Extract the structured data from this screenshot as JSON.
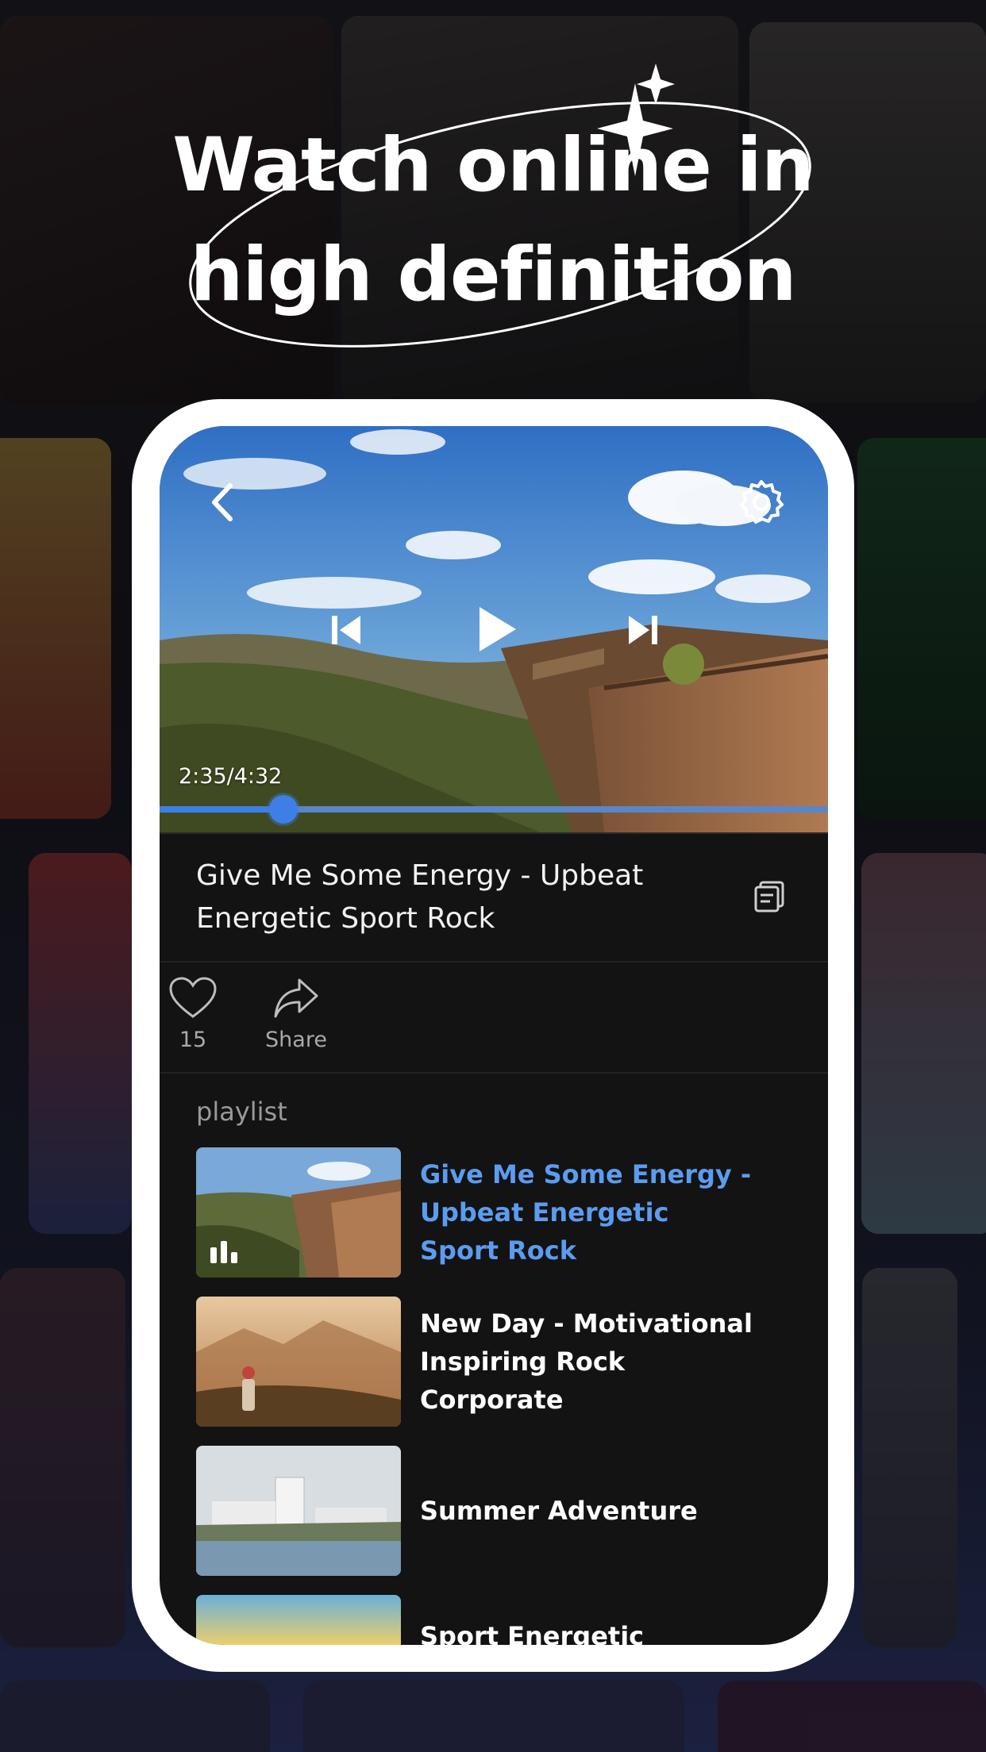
{
  "headline": {
    "line1": "Watch online in",
    "line2": "high definition"
  },
  "player": {
    "time": "2:35/4:32",
    "progress": 0.185,
    "back_icon": "chevron-left-icon",
    "settings_icon": "gear-icon",
    "prev_icon": "skip-previous-icon",
    "play_icon": "play-icon",
    "next_icon": "skip-next-icon"
  },
  "song": {
    "title": "Give Me Some Energy - Upbeat Energetic Sport Rock",
    "copy_icon": "copy-icon"
  },
  "actions": {
    "like_count": "15",
    "share_label": "Share"
  },
  "playlist": {
    "heading": "playlist",
    "items": [
      {
        "title": "Give Me Some Energy - Upbeat Energetic Sport Rock",
        "active": true
      },
      {
        "title": "New Day - Motivational Inspiring Rock Corporate",
        "active": false
      },
      {
        "title": "Summer Adventure",
        "active": false
      },
      {
        "title": "Sport Energetic",
        "active": false
      }
    ]
  },
  "colors": {
    "accent": "#3d7fe6",
    "active_title": "#5b9cf0",
    "screen_bg": "#131313",
    "phone_frame": "#ffffff"
  }
}
